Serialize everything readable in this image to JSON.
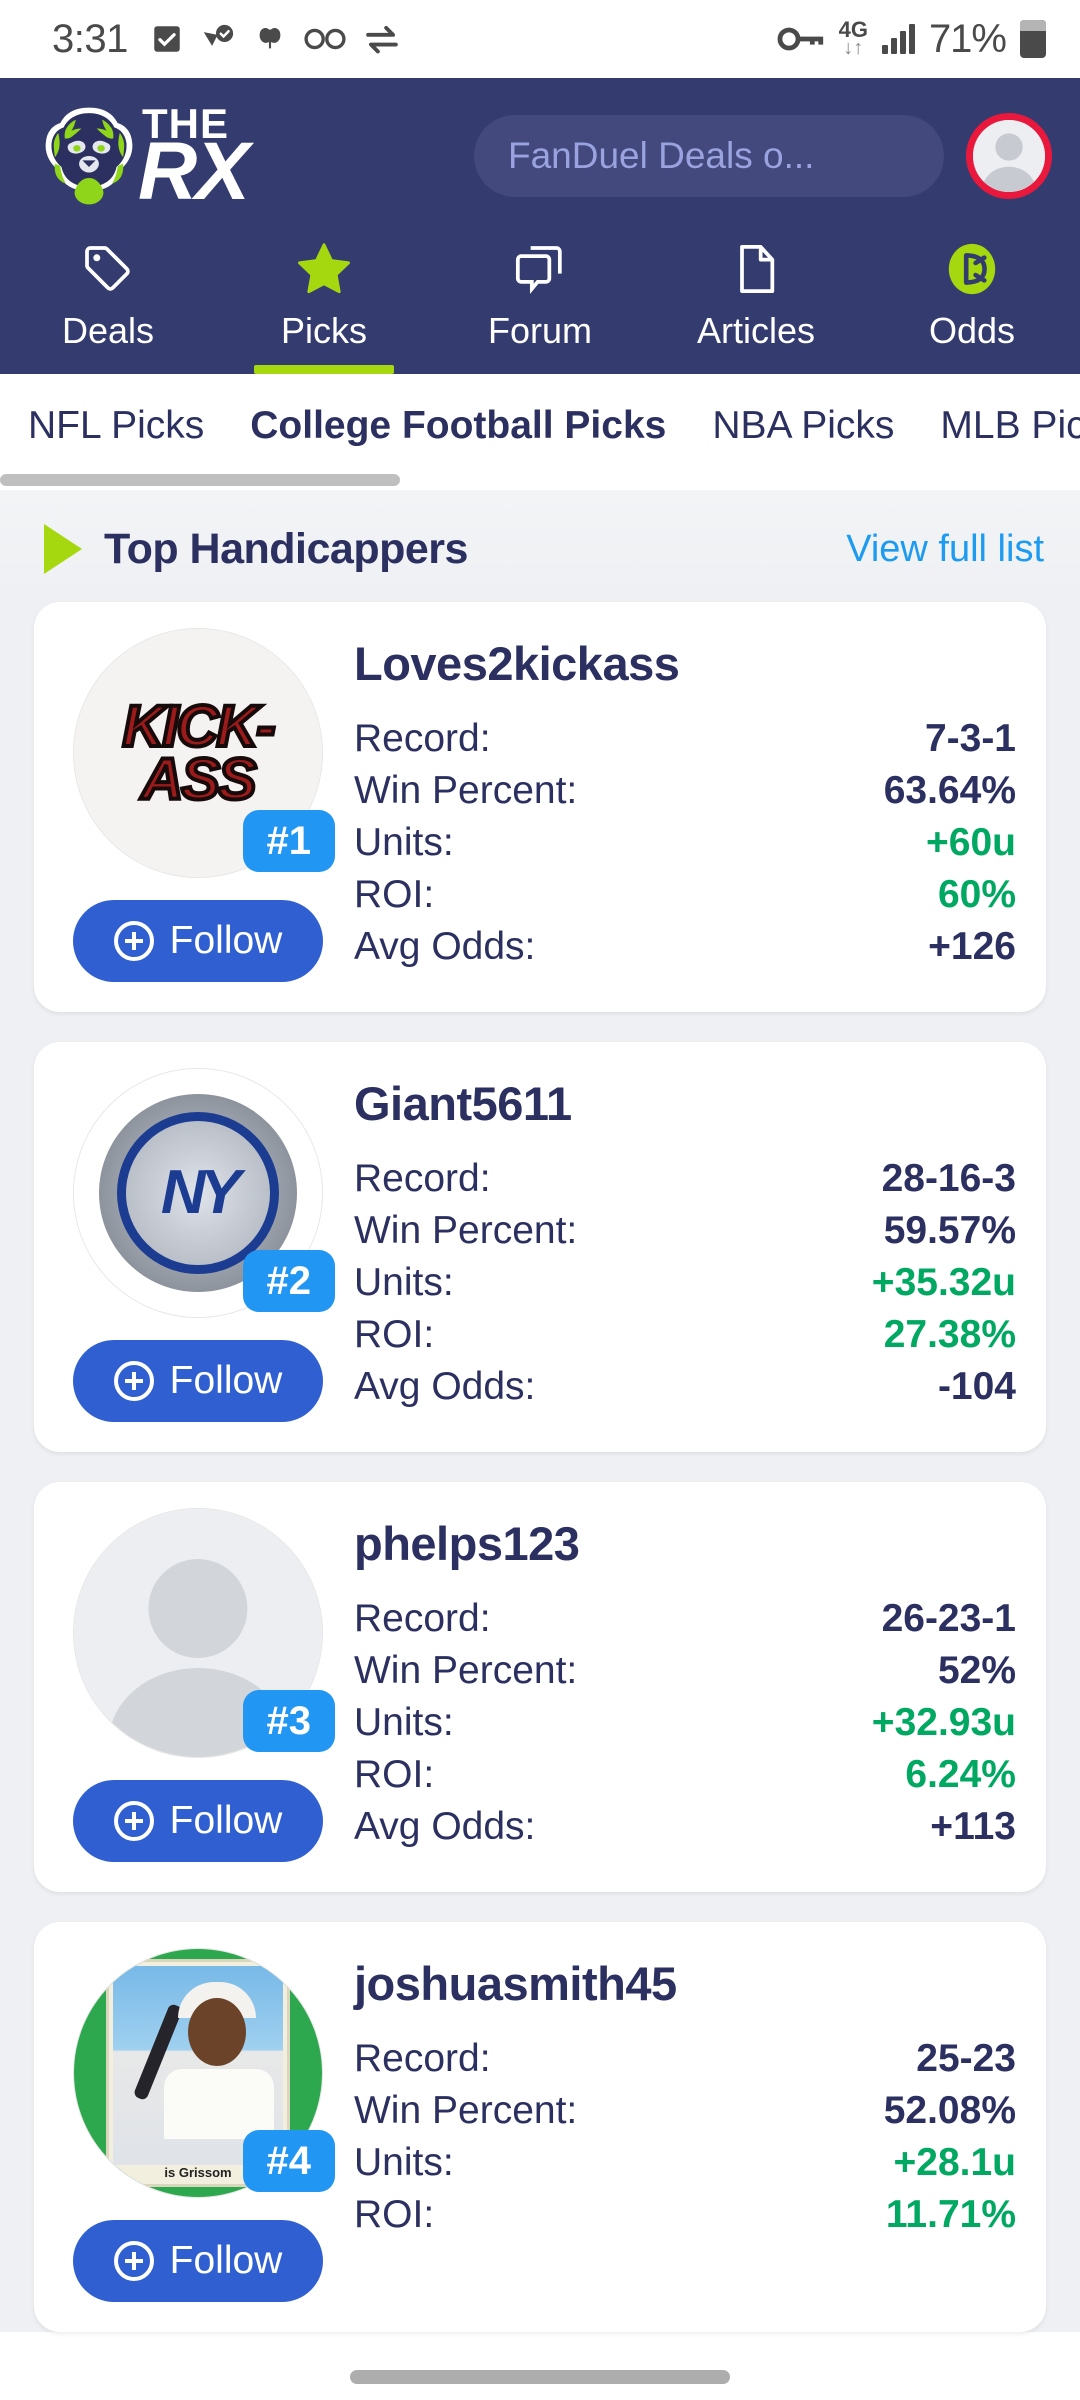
{
  "status_bar": {
    "time": "3:31",
    "battery_percent": "71%",
    "network": "4G",
    "left_icons": [
      "checkbox-checked-icon",
      "location-check-icon",
      "butterfly-icon",
      "voicemail-icon",
      "transfer-icon"
    ],
    "right_icons": [
      "vpn-key-icon",
      "mobile-data-icon",
      "signal-bars-icon",
      "battery-icon"
    ]
  },
  "header": {
    "logo_top": "THE",
    "logo_bottom": "RX",
    "search": {
      "placeholder": "FanDuel Deals o...",
      "value": ""
    },
    "nav": [
      {
        "label": "Deals",
        "icon": "tag-icon",
        "active": false
      },
      {
        "label": "Picks",
        "icon": "star-icon",
        "active": true
      },
      {
        "label": "Forum",
        "icon": "forum-icon",
        "active": false
      },
      {
        "label": "Articles",
        "icon": "document-icon",
        "active": false
      },
      {
        "label": "Odds",
        "icon": "odds-icon",
        "active": false
      }
    ]
  },
  "subtabs": [
    {
      "label": "NFL Picks",
      "active": false
    },
    {
      "label": "College Football Picks",
      "active": true
    },
    {
      "label": "NBA Picks",
      "active": false
    },
    {
      "label": "MLB Picks",
      "active": false
    }
  ],
  "section": {
    "title": "Top Handicappers",
    "link": "View full list"
  },
  "follow_label": "Follow",
  "stat_labels": {
    "record": "Record:",
    "win_percent": "Win Percent:",
    "units": "Units:",
    "roi": "ROI:",
    "avg_odds": "Avg Odds:"
  },
  "colors": {
    "header_bg": "#343b6e",
    "accent_green": "#a6d80f",
    "positive_green": "#00a862",
    "link_blue": "#1d9bf0",
    "badge_blue": "#2196f3",
    "follow_blue": "#2f5fd0",
    "navy_text": "#2b3060"
  },
  "handicappers": [
    {
      "rank": "#1",
      "username": "Loves2kickass",
      "avatar_type": "kickass-image",
      "avatar_text_1": "KICK-",
      "avatar_text_2": "ASS",
      "record": "7-3-1",
      "win_percent": "63.64%",
      "units": "+60u",
      "roi": "60%",
      "avg_odds": "+126"
    },
    {
      "rank": "#2",
      "username": "Giant5611",
      "avatar_type": "giants-ring-image",
      "avatar_text_1": "NY",
      "record": "28-16-3",
      "win_percent": "59.57%",
      "units": "+35.32u",
      "roi": "27.38%",
      "avg_odds": "-104"
    },
    {
      "rank": "#3",
      "username": "phelps123",
      "avatar_type": "default-person-avatar",
      "record": "26-23-1",
      "win_percent": "52%",
      "units": "+32.93u",
      "roi": "6.24%",
      "avg_odds": "+113"
    },
    {
      "rank": "#4",
      "username": "joshuasmith45",
      "avatar_type": "baseball-card-image",
      "avatar_text_1": "is Grissom",
      "record": "25-23",
      "win_percent": "52.08%",
      "units": "+28.1u",
      "roi": "11.71%",
      "avg_odds": ""
    }
  ]
}
